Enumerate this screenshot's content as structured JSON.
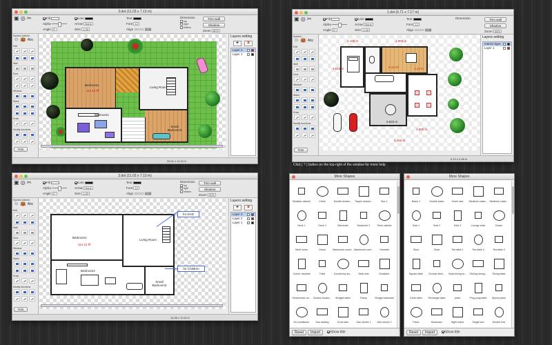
{
  "windows": {
    "w1": {
      "title": "3.dot (11.03 x 7.13 m)"
    },
    "w2": {
      "title": "1.dot (6.71 x 7.17 m)"
    },
    "w3": {
      "title": "3.dot (11.03 x 7.13 m)"
    }
  },
  "toolbar": {
    "fill": "Fill",
    "line": "Line",
    "alpha": "Alpha",
    "arrow": "Arrow",
    "angle": "Angle",
    "size": "Size",
    "text": "Text",
    "font": "Font",
    "align": "Align",
    "dimension": "Dimension",
    "dim_top": "top",
    "dim_right": "right",
    "dim_bottom": "bottom",
    "dim_left": "left",
    "trim_wall": "Trim wall",
    "shadow": "Shadow",
    "zoom": "Zoom",
    "zoom_value": "80%",
    "zoom_value_2": "95%",
    "zoom_value_3": "90%",
    "angle_value": "0°",
    "size_value": "1.00",
    "font_value": "12",
    "arrow_value": "None",
    "alpha_value": "100%"
  },
  "left_panel": {
    "symbol": "Symbol",
    "interior": "Interior",
    "edit": "Edit",
    "wall": "Wall",
    "door": "Door",
    "window": "Window",
    "stairs": "Stairs",
    "draw": "Draw",
    "modify_functions": "Modify functions",
    "trim": "Trim",
    "label_abc": "Abc"
  },
  "layers": {
    "title": "Layers setting",
    "w1": [
      "Layer 2",
      "Layer 1"
    ],
    "w2": [
      "Interior layer",
      "Layer 1"
    ],
    "w3": [
      "Layer 3",
      "Layer 2",
      "Layer 1"
    ]
  },
  "plan1": {
    "rooms": [
      "Bedroom1",
      "Living Room",
      "Bedroom2",
      "Small Bedroom3"
    ],
    "dimension": "114.10 ft²"
  },
  "plan2": {
    "dims": [
      "2.165 m",
      "1.855 m",
      "5.12 m²",
      "3.515 m",
      "0.823 m",
      "1.005 m",
      "2.455 m",
      "1.12 m"
    ]
  },
  "plan3": {
    "rooms": [
      "Bedroom1",
      "Living Room",
      "Bedroom2",
      "Small Bedroom3"
    ],
    "dimension": "114.10 ft²",
    "callouts": [
      "for DAD",
      "for Children"
    ]
  },
  "status": {
    "w1": "26.01 x 10.31 ft",
    "w2": "8.13 x 2.88 m",
    "w3": "14.55 x 10.61 ft",
    "help": "Click [ ? ] button on the top-right of the window for more help"
  },
  "more_shapes_1": {
    "title": "More Shapes",
    "items": [
      "Bedside cabinet",
      "Chest",
      "Double drawer...",
      "Tripper drawer...",
      "Box 1",
      "Desk 1",
      "Desk 2",
      "Wardrobe",
      "Wardrobe 2",
      "Shoe cabinet",
      "Multi urinal",
      "Urinal",
      "Washroom count...",
      "Washroom cont...",
      "Handrail",
      "Corner handrail",
      "Toilet",
      "Countertop sin...",
      "Multi sink",
      "Escalator",
      "Ornamental col...",
      "Scissor escala...",
      "Straight stairs",
      "Ramp",
      "Straight staircase",
      "Air conditioner",
      "Sun landing",
      "Drum sink",
      "Gas stoves 1",
      "Gas stoves 2"
    ],
    "reset": "Reset",
    "import": "Import",
    "show_title": "Show title"
  },
  "more_shapes_2": {
    "title": "More Shapes",
    "items": [
      "Basin 2",
      "Double basin",
      "Towel rack",
      "Medicine cabin...",
      "Medicine cabin...",
      "Sofa 1",
      "Sofa 2",
      "Sofa 3",
      "Lounge chair",
      "Chairs",
      "Stool",
      "Chair",
      "Tea table 1",
      "Tea table 2",
      "Tea table 3",
      "Square table",
      "Circular dinin...",
      "Bowl dining ta...",
      "Oblong dining...",
      "Dining table",
      "Circle table",
      "Rectangle table",
      "plant",
      "Ping pong table",
      "Spinet piano",
      "Piano",
      "Bookcase",
      "Night stand",
      "Single bed",
      "Double bed"
    ],
    "reset": "Reset",
    "import": "Import",
    "show_title": "Show title"
  }
}
